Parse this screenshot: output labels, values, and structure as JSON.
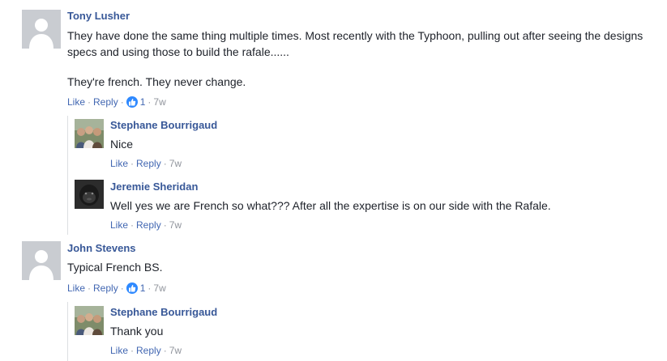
{
  "comments": [
    {
      "author": "Tony Lusher",
      "text1": "They have done the same thing multiple times. Most recently with the Typhoon, pulling out after seeing the designs specs and using those to build the rafale......",
      "text2": "They're french. They never change.",
      "like": "Like",
      "reply": "Reply",
      "reactions": "1",
      "time": "7w",
      "replies": [
        {
          "author": "Stephane Bourrigaud",
          "text": "Nice",
          "like": "Like",
          "reply": "Reply",
          "time": "7w"
        },
        {
          "author": "Jeremie Sheridan",
          "text": "Well yes we are French so what??? After all the expertise is on our side with the Rafale.",
          "like": "Like",
          "reply": "Reply",
          "time": "7w"
        }
      ]
    },
    {
      "author": "John Stevens",
      "text1": "Typical French BS.",
      "like": "Like",
      "reply": "Reply",
      "reactions": "1",
      "time": "7w",
      "replies": [
        {
          "author": "Stephane Bourrigaud",
          "text": "Thank you",
          "like": "Like",
          "reply": "Reply",
          "time": "7w"
        }
      ]
    }
  ],
  "icons": {
    "default_avatar": "person-silhouette-icon",
    "reaction": "thumbs-up-icon"
  },
  "colors": {
    "name": "#385898",
    "link": "#4267b2",
    "meta": "#90949c",
    "reaction": "#2e89ff"
  }
}
